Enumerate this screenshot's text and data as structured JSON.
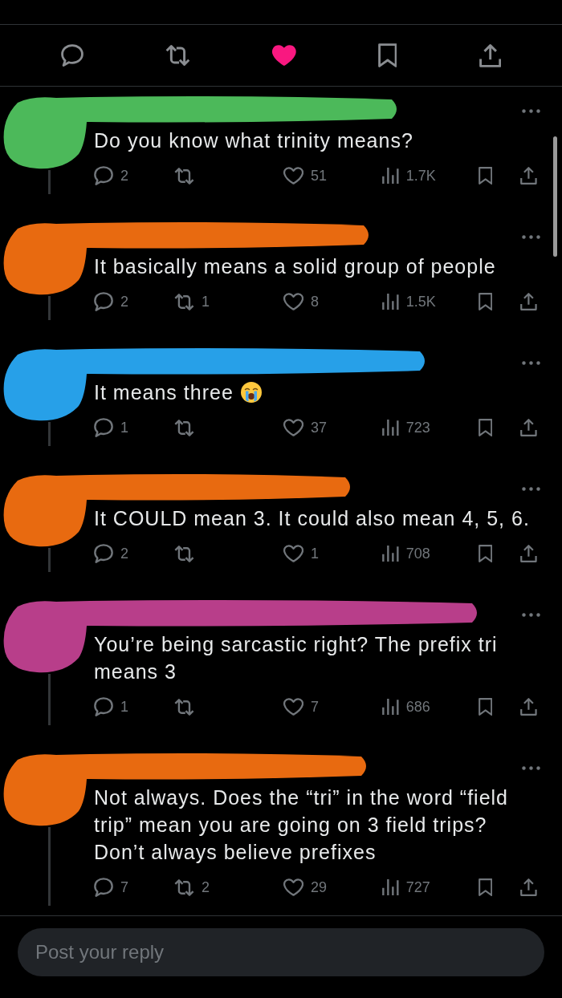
{
  "post_actions": {
    "liked": true
  },
  "replies": [
    {
      "color": "#4cb95a",
      "text": "Do you know what trinity means?",
      "emoji": false,
      "liked": false,
      "replies": "2",
      "likes": "51",
      "views": "1.7K"
    },
    {
      "color": "#e86a10",
      "text": "It basically means a solid group of people",
      "emoji": false,
      "liked": false,
      "replies": "2",
      "reposts": "1",
      "likes": "8",
      "views": "1.5K"
    },
    {
      "color": "#27a0e8",
      "text": "It means three",
      "emoji": true,
      "liked": false,
      "replies": "1",
      "likes": "37",
      "views": "723"
    },
    {
      "color": "#e86a10",
      "text": "It COULD mean 3. It could also mean 4, 5, 6.",
      "emoji": false,
      "liked": false,
      "replies": "2",
      "likes": "1",
      "views": "708"
    },
    {
      "color": "#b83e8a",
      "text": "You’re being sarcastic right? The prefix tri means 3",
      "emoji": false,
      "liked": false,
      "replies": "1",
      "likes": "7",
      "views": "686"
    },
    {
      "color": "#e86a10",
      "text": "Not always. Does the “tri” in the word “field trip” mean you are going on 3 field trips? Don’t always believe prefixes",
      "emoji": false,
      "liked": false,
      "replies": "7",
      "reposts": "2",
      "likes": "29",
      "views": "727"
    }
  ],
  "reply_field": {
    "placeholder": "Post your reply"
  }
}
